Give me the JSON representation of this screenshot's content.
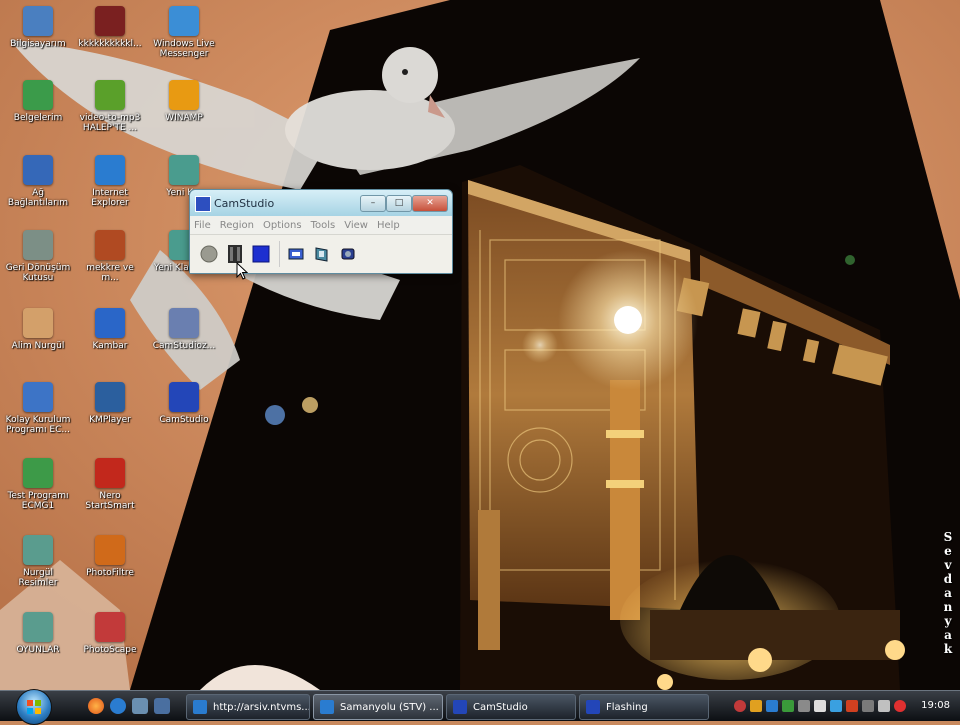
{
  "desktop": {
    "icons": [
      {
        "label": "Bilgisayarım",
        "icon": "computer-icon",
        "color": "#4a7fc0"
      },
      {
        "label": "kkkkkkkkkkl...",
        "icon": "user-photo-icon",
        "color": "#7a2020"
      },
      {
        "label": "Windows Live Messenger",
        "icon": "messenger-icon",
        "color": "#3b8ed6"
      },
      {
        "label": "Belgelerim",
        "icon": "documents-icon",
        "color": "#3b9b4a"
      },
      {
        "label": "video-to-mp3 HALEP'TE ...",
        "icon": "media-icon",
        "color": "#5aa02a"
      },
      {
        "label": "WINAMP",
        "icon": "winamp-icon",
        "color": "#e89a12"
      },
      {
        "label": "Ağ Bağlantılarım",
        "icon": "network-icon",
        "color": "#3568b8"
      },
      {
        "label": "Internet Explorer",
        "icon": "ie-icon",
        "color": "#2a7cd0"
      },
      {
        "label": "Yeni K...",
        "icon": "folder-icon",
        "color": "#4a9c8e"
      },
      {
        "label": "Geri Dönüşüm Kutusu",
        "icon": "recycle-bin-icon",
        "color": "#7c8f86"
      },
      {
        "label": "mekkre ve m...",
        "icon": "image-file-icon",
        "color": "#b04a22"
      },
      {
        "label": "Yeni Klasör ...",
        "icon": "folder-icon",
        "color": "#4a9c8e"
      },
      {
        "label": "Alim Nurgül",
        "icon": "people-icon",
        "color": "#d3a06a"
      },
      {
        "label": "Kambar",
        "icon": "book-icon",
        "color": "#2a66c8"
      },
      {
        "label": "CamStudioz...",
        "icon": "shortcut-icon",
        "color": "#6a7fb0"
      },
      {
        "label": "Kolay Kurulum Programı EC...",
        "icon": "setup-icon",
        "color": "#3d74c6"
      },
      {
        "label": "KMPlayer",
        "icon": "kmplayer-icon",
        "color": "#2b5f9e"
      },
      {
        "label": "CamStudio",
        "icon": "camstudio-icon",
        "color": "#2346b8"
      },
      {
        "label": "Test Programı ECMG1",
        "icon": "test-program-icon",
        "color": "#3d9a48"
      },
      {
        "label": "Nero StartSmart",
        "icon": "nero-icon",
        "color": "#c2281c"
      },
      {
        "label": "Nurgül Resimler",
        "icon": "folder-icon",
        "color": "#5a9c8e"
      },
      {
        "label": "PhotoFiltre",
        "icon": "photofiltre-icon",
        "color": "#d06a1a"
      },
      {
        "label": "OYUNLAR",
        "icon": "folder-icon",
        "color": "#5a9c8e"
      },
      {
        "label": "PhotoScape",
        "icon": "photoscape-icon",
        "color": "#c23a3a"
      }
    ]
  },
  "camstudio": {
    "title": "CamStudio",
    "minimize": "–",
    "maximize": "□",
    "close": "✕",
    "menu": [
      "File",
      "Region",
      "Options",
      "Tools",
      "View",
      "Help"
    ],
    "toolbar": [
      {
        "name": "record-button",
        "icon": "record-circle-icon"
      },
      {
        "name": "pause-button",
        "icon": "pause-icon"
      },
      {
        "name": "stop-button",
        "icon": "stop-square-icon"
      },
      {
        "name": "autopan-button",
        "icon": "autopan-icon"
      },
      {
        "name": "annotation-button",
        "icon": "annotation-icon"
      },
      {
        "name": "audio-button",
        "icon": "audio-icon"
      }
    ]
  },
  "taskbar": {
    "tasks": [
      {
        "label": "http://arsiv.ntvms...",
        "icon": "ie-icon",
        "color": "#2a7cd0",
        "active": false
      },
      {
        "label": "Samanyolu (STV) ...",
        "icon": "ie-icon",
        "color": "#2a7cd0",
        "active": true
      },
      {
        "label": "CamStudio",
        "icon": "camstudio-icon",
        "color": "#2346b8",
        "active": false
      },
      {
        "label": "Flashing",
        "icon": "camstudio-icon",
        "color": "#2346b8",
        "active": false
      }
    ],
    "quick_launch": [
      "firefox-icon",
      "ie-icon",
      "show-desktop-icon",
      "switch-windows-icon"
    ],
    "clock": "19:08"
  },
  "signature": "Sevdanyak",
  "colors": {
    "wallpaper_orange": "#c98a5e",
    "wall_black": "#0b0604",
    "kaaba_gold": "#b3793c"
  }
}
